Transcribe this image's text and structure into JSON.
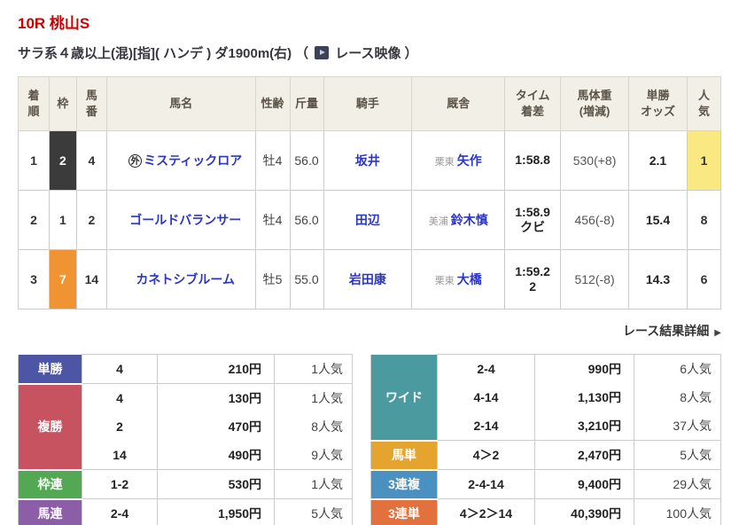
{
  "page": {
    "title": "10R 桃山S",
    "conditions": "サラ系４歳以上(混)[指]( ハンデ ) ダ1900m(右)",
    "video_paren_open": "（",
    "video_label": "レース映像",
    "video_paren_close": "）",
    "detail_link": "レース結果詳細",
    "detail_arrow": "▶"
  },
  "results_table": {
    "headers": {
      "place": [
        "着",
        "順"
      ],
      "frame": [
        "枠"
      ],
      "number": [
        "馬",
        "番"
      ],
      "name": [
        "馬名"
      ],
      "sex_age": [
        "性齢"
      ],
      "weight": [
        "斤量"
      ],
      "jockey": [
        "騎手"
      ],
      "stable": [
        "厩舎"
      ],
      "time": [
        "タイム",
        "着差"
      ],
      "body_weight": [
        "馬体重",
        "(増減)"
      ],
      "odds": [
        "単勝",
        "オッズ"
      ],
      "popularity": [
        "人",
        "気"
      ]
    },
    "rows": [
      {
        "place": "1",
        "frame": "2",
        "frame_bg": "#3b3b3b",
        "frame_fg": "#ffffff",
        "number": "4",
        "mark": "外",
        "name": "ミスティックロア",
        "sex_age": "牡4",
        "weight": "56.0",
        "jockey": "坂井",
        "stable_region": "栗東",
        "stable": "矢作",
        "time": "1:58.8",
        "margin": "",
        "body_weight": "530(+8)",
        "odds": "2.1",
        "popularity": "1",
        "pop_bg": "#fae982"
      },
      {
        "place": "2",
        "frame": "1",
        "frame_bg": "#ffffff",
        "frame_fg": "#333333",
        "number": "2",
        "mark": "",
        "name": "ゴールドバランサー",
        "sex_age": "牡4",
        "weight": "56.0",
        "jockey": "田辺",
        "stable_region": "美浦",
        "stable": "鈴木慎",
        "time": "1:58.9",
        "margin": "クビ",
        "body_weight": "456(-8)",
        "odds": "15.4",
        "popularity": "8",
        "pop_bg": "#ffffff"
      },
      {
        "place": "3",
        "frame": "7",
        "frame_bg": "#ef9333",
        "frame_fg": "#ffffff",
        "number": "14",
        "mark": "",
        "name": "カネトシブルーム",
        "sex_age": "牡5",
        "weight": "55.0",
        "jockey": "岩田康",
        "stable_region": "栗東",
        "stable": "大橋",
        "time": "1:59.2",
        "margin": "2",
        "body_weight": "512(-8)",
        "odds": "14.3",
        "popularity": "6",
        "pop_bg": "#ffffff"
      }
    ]
  },
  "payouts": {
    "left": [
      {
        "label": "単勝",
        "color": "#4d55a5",
        "lines": [
          {
            "comb": "4",
            "pay": "210円",
            "pop": "1人気"
          }
        ]
      },
      {
        "label": "複勝",
        "color": "#c75360",
        "lines": [
          {
            "comb": "4",
            "pay": "130円",
            "pop": "1人気"
          },
          {
            "comb": "2",
            "pay": "470円",
            "pop": "8人気"
          },
          {
            "comb": "14",
            "pay": "490円",
            "pop": "9人気"
          }
        ]
      },
      {
        "label": "枠連",
        "color": "#53a953",
        "lines": [
          {
            "comb": "1-2",
            "pay": "530円",
            "pop": "1人気"
          }
        ]
      },
      {
        "label": "馬連",
        "color": "#8b5ea7",
        "lines": [
          {
            "comb": "2-4",
            "pay": "1,950円",
            "pop": "5人気"
          }
        ]
      }
    ],
    "right": [
      {
        "label": "ワイド",
        "color": "#4a9a9f",
        "lines": [
          {
            "comb": "2-4",
            "pay": "990円",
            "pop": "6人気"
          },
          {
            "comb": "4-14",
            "pay": "1,130円",
            "pop": "8人気"
          },
          {
            "comb": "2-14",
            "pay": "3,210円",
            "pop": "37人気"
          }
        ]
      },
      {
        "label": "馬単",
        "color": "#e5a42e",
        "lines": [
          {
            "comb": "4＞2",
            "pay": "2,470円",
            "pop": "5人気"
          }
        ]
      },
      {
        "label": "3連複",
        "color": "#4a90c0",
        "lines": [
          {
            "comb": "2-4-14",
            "pay": "9,400円",
            "pop": "29人気"
          }
        ]
      },
      {
        "label": "3連単",
        "color": "#e2713d",
        "lines": [
          {
            "comb": "4＞2＞14",
            "pay": "40,390円",
            "pop": "100人気"
          }
        ]
      }
    ]
  }
}
